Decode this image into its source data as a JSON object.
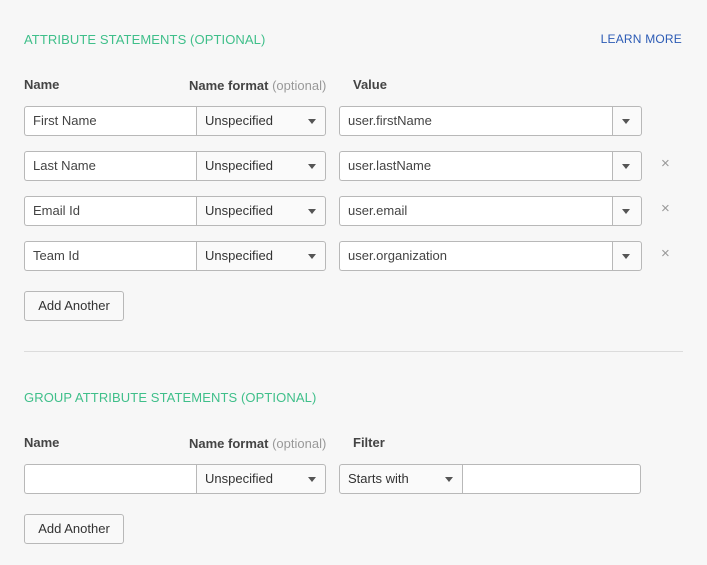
{
  "attribute_section": {
    "title": "ATTRIBUTE STATEMENTS (OPTIONAL)",
    "learn_more": "LEARN MORE",
    "col_name": "Name",
    "col_format": "Name format",
    "col_format_optional": "(optional)",
    "col_value": "Value",
    "rows": [
      {
        "name": "First Name",
        "format": "Unspecified",
        "value": "user.firstName"
      },
      {
        "name": "Last Name",
        "format": "Unspecified",
        "value": "user.lastName"
      },
      {
        "name": "Email Id",
        "format": "Unspecified",
        "value": "user.email"
      },
      {
        "name": "Team Id",
        "format": "Unspecified",
        "value": "user.organization"
      }
    ],
    "remove_glyph": "×",
    "add_another": "Add Another"
  },
  "group_section": {
    "title": "GROUP ATTRIBUTE STATEMENTS (OPTIONAL)",
    "col_name": "Name",
    "col_format": "Name format",
    "col_format_optional": "(optional)",
    "col_filter": "Filter",
    "row": {
      "name": "",
      "format": "Unspecified",
      "filter": "Starts with",
      "filter_value": ""
    },
    "add_another": "Add Another"
  },
  "icons": {
    "dropdown": "chevron-down-icon",
    "remove": "close-icon"
  },
  "colors": {
    "section_title": "#3fbf8a",
    "link": "#2c5bb5"
  }
}
